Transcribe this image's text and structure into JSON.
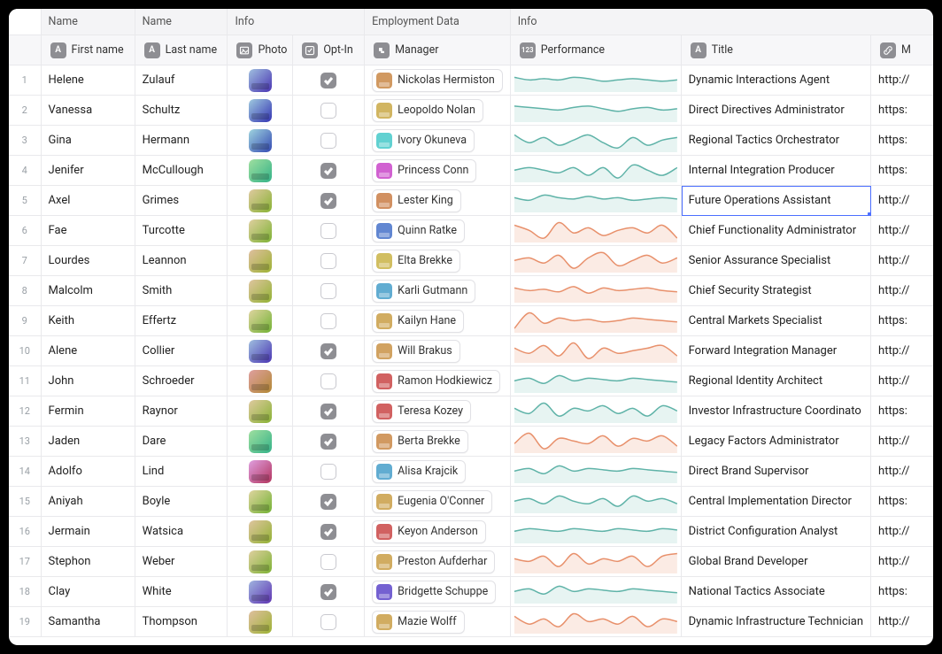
{
  "groupHeaders": {
    "g1": "Name",
    "g2": "Name",
    "g3": "Info",
    "g4": "Employment Data",
    "g5": "Info"
  },
  "columns": {
    "first": "First name",
    "last": "Last name",
    "photo": "Photo",
    "optin": "Opt-In",
    "mgr": "Manager",
    "perf": "Performance",
    "title": "Title",
    "url": "M"
  },
  "selected": {
    "row": 4,
    "col": "title"
  },
  "rows": [
    {
      "first": "Helene",
      "last": "Zulauf",
      "optin": true,
      "mgr": "Nickolas Hermiston",
      "title": "Dynamic Interactions Agent",
      "url": "http://",
      "photoHue": 210,
      "avHue": 30,
      "sparkColor": "teal",
      "spark": [
        14,
        12,
        13,
        12,
        14,
        13,
        11,
        12,
        13,
        12,
        11,
        12
      ]
    },
    {
      "first": "Vanessa",
      "last": "Schultz",
      "optin": false,
      "mgr": "Leopoldo Nolan",
      "title": "Direct Directives Administrator",
      "url": "https:",
      "photoHue": 200,
      "avHue": 45,
      "sparkColor": "teal",
      "spark": [
        15,
        14,
        13,
        12,
        14,
        15,
        13,
        11,
        13,
        14,
        12,
        13
      ]
    },
    {
      "first": "Gina",
      "last": "Hermann",
      "optin": false,
      "mgr": "Ivory Okuneva",
      "title": "Regional Tactics Orchestrator",
      "url": "https:",
      "photoHue": 190,
      "avHue": 180,
      "sparkColor": "teal",
      "spark": [
        16,
        10,
        14,
        8,
        12,
        16,
        10,
        6,
        14,
        8,
        12,
        14
      ]
    },
    {
      "first": "Jenifer",
      "last": "McCullough",
      "optin": true,
      "mgr": "Princess Conn",
      "title": "Internal Integration Producer",
      "url": "https:",
      "photoHue": 120,
      "avHue": 300,
      "sparkColor": "teal",
      "spark": [
        12,
        14,
        12,
        10,
        14,
        8,
        14,
        6,
        16,
        12,
        8,
        14
      ]
    },
    {
      "first": "Axel",
      "last": "Grimes",
      "optin": true,
      "mgr": "Lester King",
      "title": "Future Operations Assistant",
      "url": "http://",
      "photoHue": 40,
      "avHue": 25,
      "sparkColor": "teal",
      "spark": [
        14,
        12,
        16,
        14,
        13,
        15,
        13,
        14,
        12,
        13,
        14,
        13
      ]
    },
    {
      "first": "Fae",
      "last": "Turcotte",
      "optin": false,
      "mgr": "Quinn Ratke",
      "title": "Chief Functionality Administrator",
      "url": "http://",
      "photoHue": 45,
      "avHue": 220,
      "sparkColor": "orange",
      "spark": [
        16,
        12,
        6,
        18,
        10,
        14,
        8,
        12,
        14,
        10,
        16,
        6
      ]
    },
    {
      "first": "Lourdes",
      "last": "Leannon",
      "optin": false,
      "mgr": "Elta Brekke",
      "title": "Senior Assurance Specialist",
      "url": "http://",
      "photoHue": 30,
      "avHue": 50,
      "sparkColor": "orange",
      "spark": [
        12,
        14,
        10,
        16,
        6,
        14,
        18,
        8,
        12,
        16,
        10,
        14
      ]
    },
    {
      "first": "Malcolm",
      "last": "Smith",
      "optin": false,
      "mgr": "Karli Gutmann",
      "title": "Chief Security Strategist",
      "url": "http://",
      "photoHue": 35,
      "avHue": 200,
      "sparkColor": "orange",
      "spark": [
        14,
        12,
        13,
        11,
        15,
        10,
        14,
        12,
        13,
        14,
        12,
        11
      ]
    },
    {
      "first": "Keith",
      "last": "Effertz",
      "optin": false,
      "mgr": "Kailyn Hane",
      "title": "Central Markets Specialist",
      "url": "https:",
      "photoHue": 50,
      "avHue": 40,
      "sparkColor": "orange",
      "spark": [
        6,
        18,
        10,
        14,
        12,
        13,
        11,
        12,
        14,
        13,
        12,
        11
      ]
    },
    {
      "first": "Alene",
      "last": "Collier",
      "optin": true,
      "mgr": "Will Brakus",
      "title": "Forward Integration Manager",
      "url": "http://",
      "photoHue": 210,
      "avHue": 35,
      "sparkColor": "orange",
      "spark": [
        14,
        10,
        16,
        8,
        18,
        6,
        14,
        10,
        12,
        14,
        16,
        8
      ]
    },
    {
      "first": "John",
      "last": "Schroeder",
      "optin": false,
      "mgr": "Ramon Hodkiewicz",
      "title": "Regional Identity Architect",
      "url": "http://",
      "photoHue": 0,
      "avHue": 0,
      "sparkColor": "teal",
      "spark": [
        12,
        14,
        10,
        16,
        12,
        14,
        13,
        12,
        14,
        13,
        12,
        11
      ]
    },
    {
      "first": "Fermin",
      "last": "Raynor",
      "optin": true,
      "mgr": "Teresa Kozey",
      "title": "Investor Infrastructure Coordinato",
      "url": "https:",
      "photoHue": 40,
      "avHue": 0,
      "sparkColor": "teal",
      "spark": [
        14,
        10,
        18,
        8,
        14,
        12,
        16,
        10,
        14,
        8,
        16,
        12
      ]
    },
    {
      "first": "Jaden",
      "last": "Dare",
      "optin": true,
      "mgr": "Berta Brekke",
      "title": "Legacy Factors Administrator",
      "url": "http://",
      "photoHue": 120,
      "avHue": 30,
      "sparkColor": "orange",
      "spark": [
        10,
        18,
        6,
        14,
        12,
        10,
        16,
        8,
        14,
        12,
        16,
        8
      ]
    },
    {
      "first": "Adolfo",
      "last": "Lind",
      "optin": false,
      "mgr": "Alisa Krajcik",
      "title": "Direct Brand Supervisor",
      "url": "http://",
      "photoHue": 300,
      "avHue": 200,
      "sparkColor": "teal",
      "spark": [
        12,
        14,
        10,
        16,
        12,
        14,
        13,
        12,
        14,
        13,
        12,
        11
      ]
    },
    {
      "first": "Aniyah",
      "last": "Boyle",
      "optin": true,
      "mgr": "Eugenia O'Conner",
      "title": "Central Implementation Director",
      "url": "https:",
      "photoHue": 50,
      "avHue": 40,
      "sparkColor": "teal",
      "spark": [
        12,
        14,
        10,
        16,
        12,
        10,
        14,
        8,
        16,
        12,
        14,
        10
      ]
    },
    {
      "first": "Jermain",
      "last": "Watsica",
      "optin": true,
      "mgr": "Keyon Anderson",
      "title": "District Configuration Analyst",
      "url": "http://",
      "photoHue": 35,
      "avHue": 0,
      "sparkColor": "teal",
      "spark": [
        12,
        14,
        13,
        12,
        14,
        13,
        12,
        14,
        13,
        12,
        14,
        13
      ]
    },
    {
      "first": "Stephon",
      "last": "Weber",
      "optin": false,
      "mgr": "Preston Aufderhar",
      "title": "Global Brand Developer",
      "url": "http://",
      "photoHue": 45,
      "avHue": 40,
      "sparkColor": "orange",
      "spark": [
        14,
        12,
        16,
        8,
        18,
        10,
        14,
        12,
        16,
        8,
        16,
        18
      ]
    },
    {
      "first": "Clay",
      "last": "White",
      "optin": true,
      "mgr": "Bridgette Schuppe",
      "title": "National Tactics Associate",
      "url": "https:",
      "photoHue": 220,
      "avHue": 250,
      "sparkColor": "teal",
      "spark": [
        12,
        14,
        10,
        16,
        12,
        14,
        13,
        12,
        14,
        13,
        12,
        11
      ]
    },
    {
      "first": "Samantha",
      "last": "Thompson",
      "optin": false,
      "mgr": "Mazie Wolff",
      "title": "Dynamic Infrastructure Technician",
      "url": "http://",
      "photoHue": 30,
      "avHue": 40,
      "sparkColor": "orange",
      "spark": [
        16,
        10,
        14,
        8,
        18,
        12,
        14,
        10,
        16,
        8,
        14,
        12
      ]
    }
  ]
}
